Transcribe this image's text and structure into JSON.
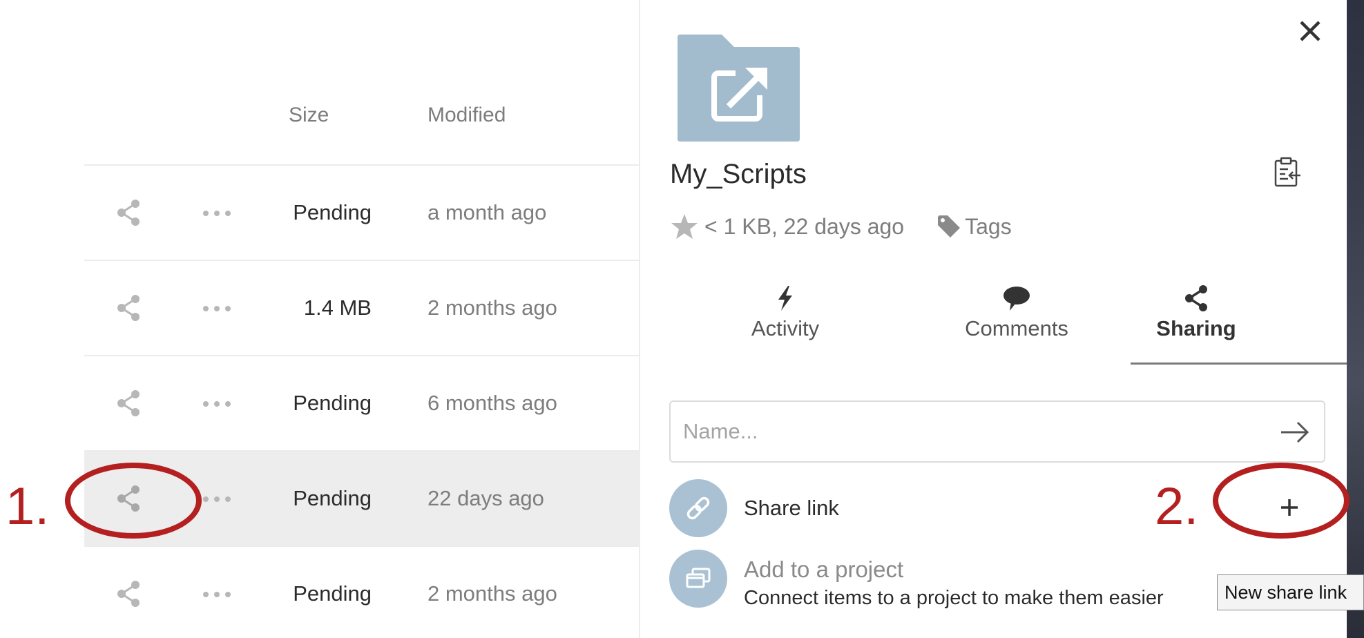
{
  "file_list": {
    "headers": {
      "size": "Size",
      "modified": "Modified"
    },
    "rows": [
      {
        "size": "Pending",
        "modified": "a month ago",
        "selected": false
      },
      {
        "size": "1.4 MB",
        "modified": "2 months ago",
        "selected": false
      },
      {
        "size": "Pending",
        "modified": "6 months ago",
        "selected": false
      },
      {
        "size": "Pending",
        "modified": "22 days ago",
        "selected": true
      },
      {
        "size": "Pending",
        "modified": "2 months ago",
        "selected": false
      }
    ]
  },
  "details": {
    "name": "My_Scripts",
    "meta": "< 1 KB, 22 days ago",
    "tags_label": "Tags",
    "tabs": [
      {
        "label": "Activity",
        "icon": "lightning-icon",
        "active": false
      },
      {
        "label": "Comments",
        "icon": "comment-bubble-icon",
        "active": false
      },
      {
        "label": "Sharing",
        "icon": "share-icon",
        "active": true
      }
    ],
    "sharing": {
      "name_placeholder": "Name...",
      "share_link_label": "Share link",
      "add_project_title": "Add to a project",
      "add_project_desc": "Connect items to a project to make them easier to find",
      "new_share_button": "+",
      "tooltip": "New share link"
    }
  },
  "annotations": {
    "step1": "1.",
    "step2": "2."
  },
  "colors": {
    "accent_circle": "#a9c1d3",
    "folder": "#a3bccd",
    "annotation_red": "#b41f1f",
    "selected_row": "#ecedec"
  }
}
